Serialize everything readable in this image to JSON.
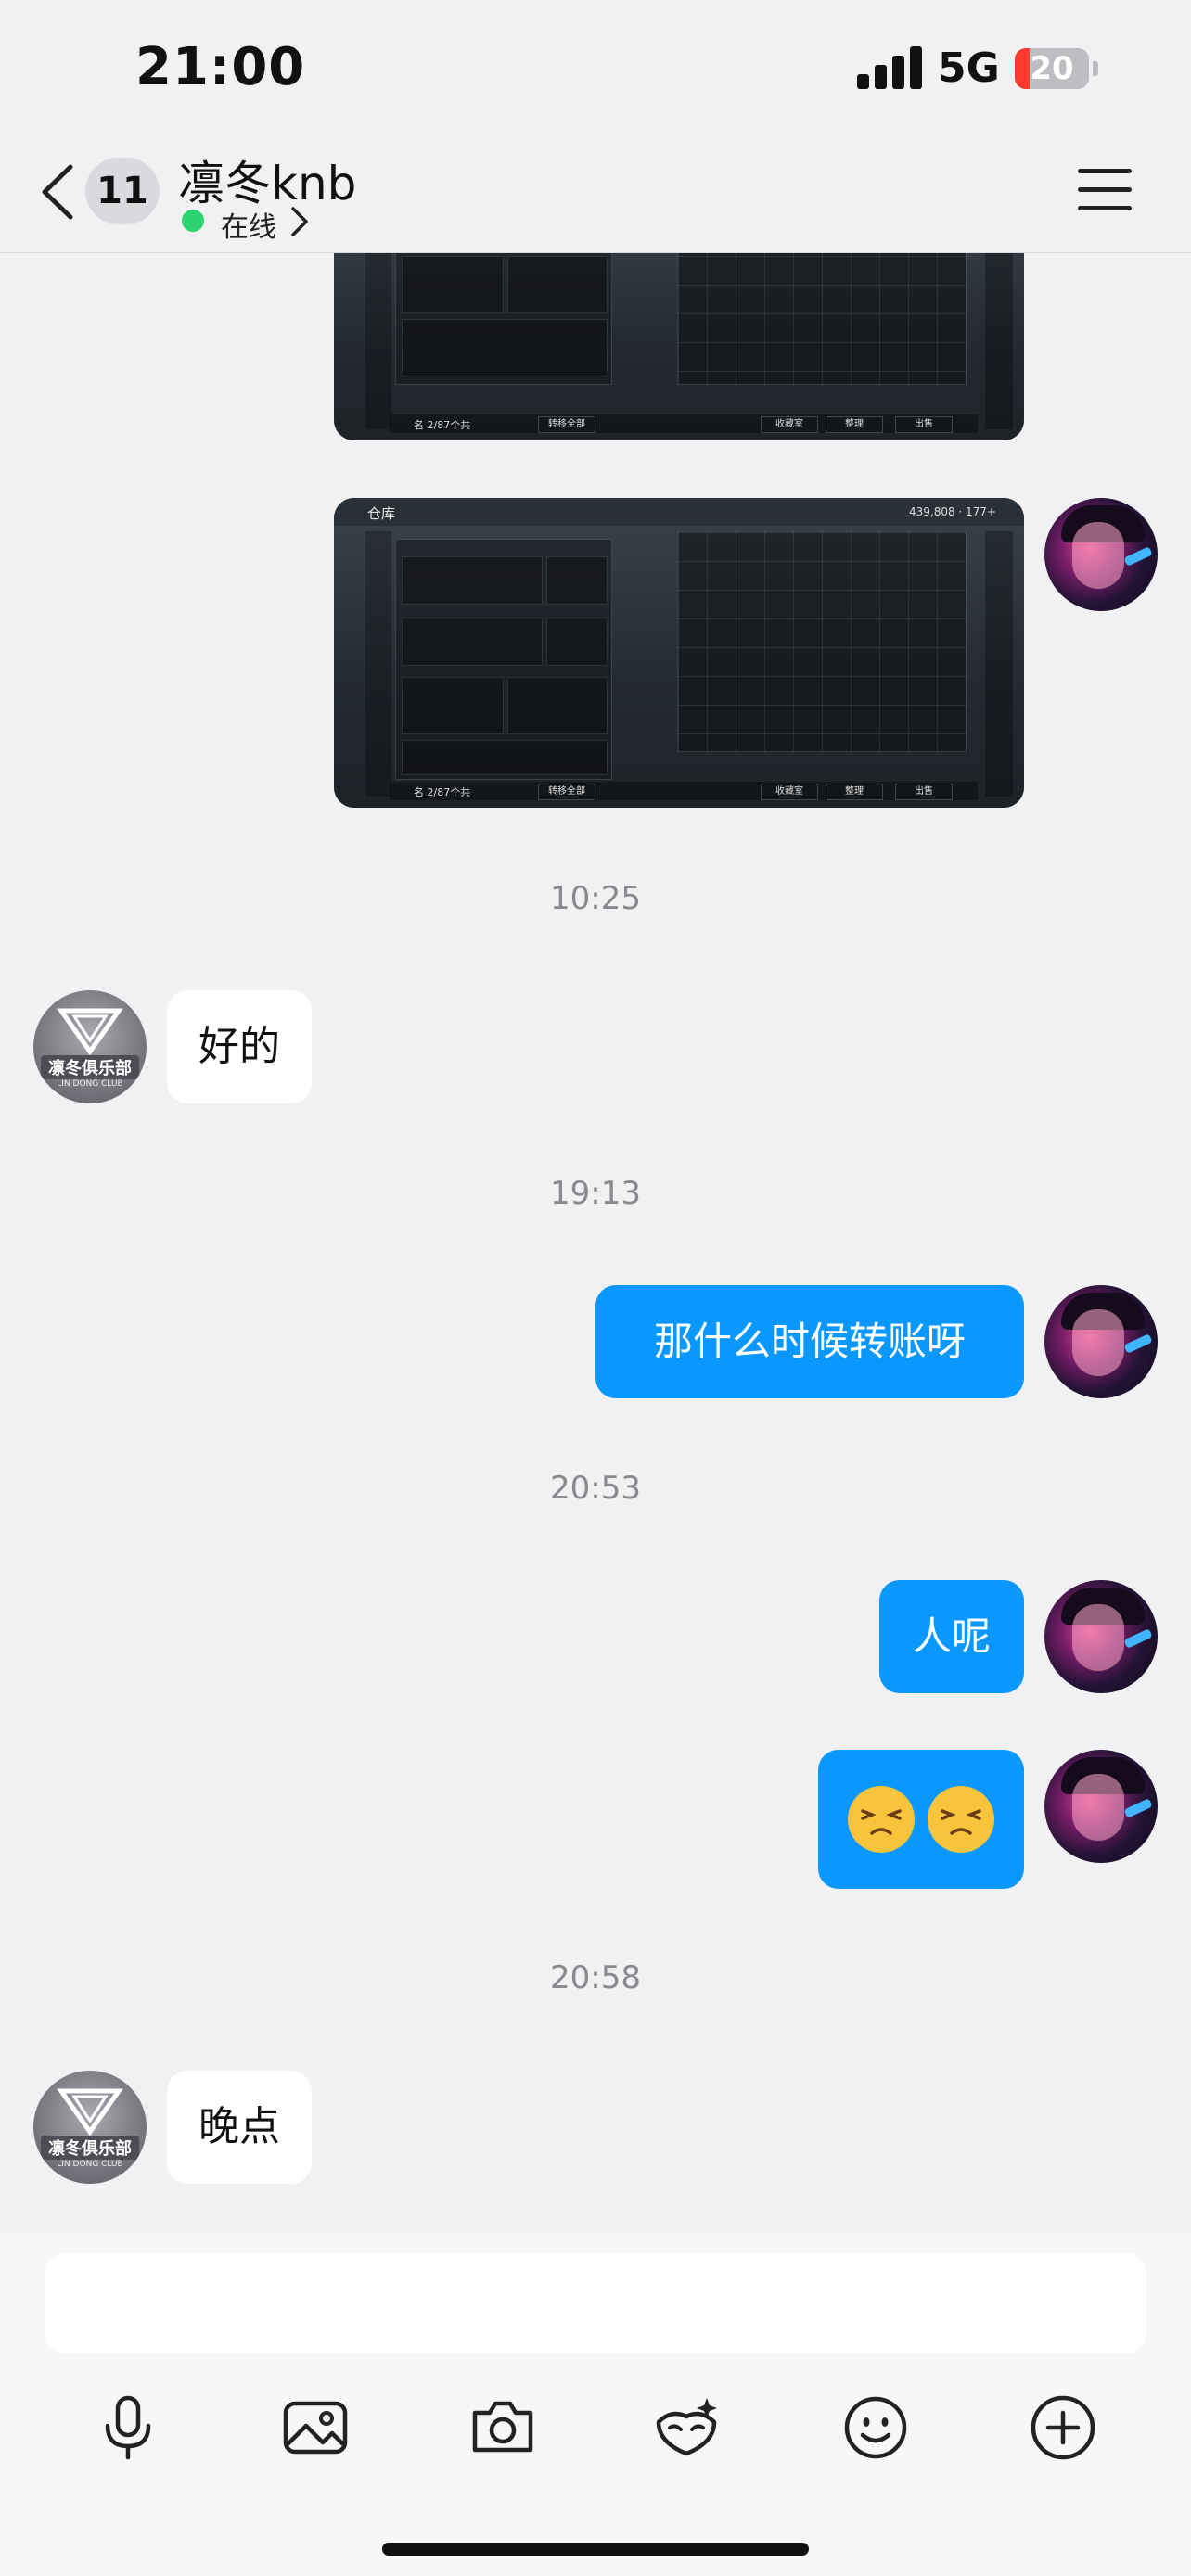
{
  "status_bar": {
    "time": "21:00",
    "network": "5G",
    "battery_percent": 20,
    "battery_label": "20",
    "battery_color": "#ff3b30"
  },
  "header": {
    "back_icon": "chevron-left-icon",
    "unread_count": "11",
    "contact_name": "凛冬knb",
    "status_text": "在线",
    "status_color": "#2dd36f",
    "menu_icon": "hamburger-menu-icon"
  },
  "messages": [
    {
      "type": "image",
      "sender": "self",
      "image_title": "",
      "bottom_left": "名 2/87个共",
      "buttons": [
        "转移全部",
        "收藏室",
        "整理",
        "出售"
      ]
    },
    {
      "type": "image",
      "sender": "self",
      "image_title": "仓库",
      "coins": "439,808 · 177+",
      "bottom_left": "名 2/87个共",
      "buttons": [
        "转移全部",
        "收藏室",
        "整理",
        "出售"
      ]
    },
    {
      "type": "timestamp",
      "text": "10:25"
    },
    {
      "type": "text",
      "sender": "other",
      "text": "好的"
    },
    {
      "type": "timestamp",
      "text": "19:13"
    },
    {
      "type": "text",
      "sender": "self",
      "text": "那什么时候转账呀"
    },
    {
      "type": "timestamp",
      "text": "20:53"
    },
    {
      "type": "text",
      "sender": "self",
      "text": "人呢"
    },
    {
      "type": "emoji",
      "sender": "self",
      "text": "😣😣",
      "emoji_name": "persevering-face"
    },
    {
      "type": "timestamp",
      "text": "20:58"
    },
    {
      "type": "text",
      "sender": "other",
      "text": "晚点"
    }
  ],
  "other_avatar": {
    "club_name": "凛冬俱乐部",
    "club_en": "LIN DONG CLUB"
  },
  "composer": {
    "input_value": "",
    "tools": [
      "microphone-icon",
      "image-icon",
      "camera-icon",
      "sticker-icon",
      "emoji-icon",
      "plus-icon"
    ]
  },
  "accent_color": "#0a98ff"
}
